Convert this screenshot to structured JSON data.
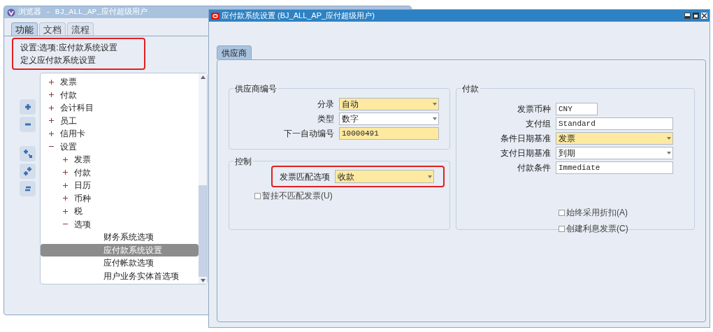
{
  "navigator": {
    "title": "浏览器 - BJ_ALL_AP_应付超级用户",
    "tabs": [
      {
        "label": "功能",
        "selected": true
      },
      {
        "label": "文档",
        "selected": false
      },
      {
        "label": "流程",
        "selected": false
      }
    ],
    "path": "设置:选项:应付款系统设置",
    "description": "定义应付款系统设置",
    "tree": [
      {
        "label": "发票",
        "kind": "folder",
        "expanded": false,
        "selected": false
      },
      {
        "label": "付款",
        "kind": "folder",
        "expanded": false,
        "selected": false
      },
      {
        "label": "会计科目",
        "kind": "folder",
        "expanded": false,
        "selected": false
      },
      {
        "label": "员工",
        "kind": "folder",
        "expanded": false,
        "selected": false
      },
      {
        "label": "信用卡",
        "kind": "folder",
        "expanded": false,
        "selected": false
      },
      {
        "label": "设置",
        "kind": "folder",
        "expanded": true,
        "selected": false,
        "children": [
          {
            "label": "发票",
            "kind": "folder",
            "expanded": false,
            "selected": false
          },
          {
            "label": "付款",
            "kind": "folder",
            "expanded": false,
            "selected": false
          },
          {
            "label": "日历",
            "kind": "folder",
            "expanded": false,
            "selected": false
          },
          {
            "label": "币种",
            "kind": "folder",
            "expanded": false,
            "selected": false
          },
          {
            "label": "税",
            "kind": "folder",
            "expanded": false,
            "selected": false
          },
          {
            "label": "选项",
            "kind": "folder",
            "expanded": true,
            "selected": false,
            "children": [
              {
                "label": "财务系统选项",
                "kind": "leaf",
                "selected": false
              },
              {
                "label": "应付款系统设置",
                "kind": "leaf",
                "selected": true
              },
              {
                "label": "应付帐款选项",
                "kind": "leaf",
                "selected": false
              },
              {
                "label": "用户业务实体首选项",
                "kind": "leaf",
                "selected": false
              }
            ]
          }
        ]
      }
    ]
  },
  "form": {
    "title": "应付款系统设置 (BJ_ALL_AP_应付超级用户)",
    "tabs": [
      {
        "label": "供应商",
        "selected": true
      }
    ],
    "supplier_numbering": {
      "title": "供应商编号",
      "fields": [
        {
          "label": "分录",
          "value": "自动",
          "kind": "select",
          "required": true
        },
        {
          "label": "类型",
          "value": "数字",
          "kind": "select",
          "required": false
        },
        {
          "label": "下一自动编号",
          "value": "10000491",
          "kind": "text",
          "required": true
        }
      ]
    },
    "control": {
      "title": "控制",
      "fields": [
        {
          "label": "发票匹配选项",
          "value": "收款",
          "kind": "select",
          "required": true
        }
      ],
      "checkboxes": [
        {
          "label": "暂挂不匹配发票(U)",
          "checked": false
        }
      ]
    },
    "payment": {
      "title": "付款",
      "fields": [
        {
          "label": "发票币种",
          "value": "CNY",
          "kind": "short",
          "required": false
        },
        {
          "label": "支付组",
          "value": "Standard",
          "kind": "text",
          "required": false
        },
        {
          "label": "条件日期基准",
          "value": "发票",
          "kind": "select",
          "required": true
        },
        {
          "label": "支付日期基准",
          "value": "到期",
          "kind": "select",
          "required": false
        },
        {
          "label": "付款条件",
          "value": "Immediate",
          "kind": "text",
          "required": false
        }
      ],
      "checkboxes": [
        {
          "label": "始终采用折扣(A)",
          "checked": false
        },
        {
          "label": "创建利息发票(C)",
          "checked": false
        }
      ]
    }
  }
}
